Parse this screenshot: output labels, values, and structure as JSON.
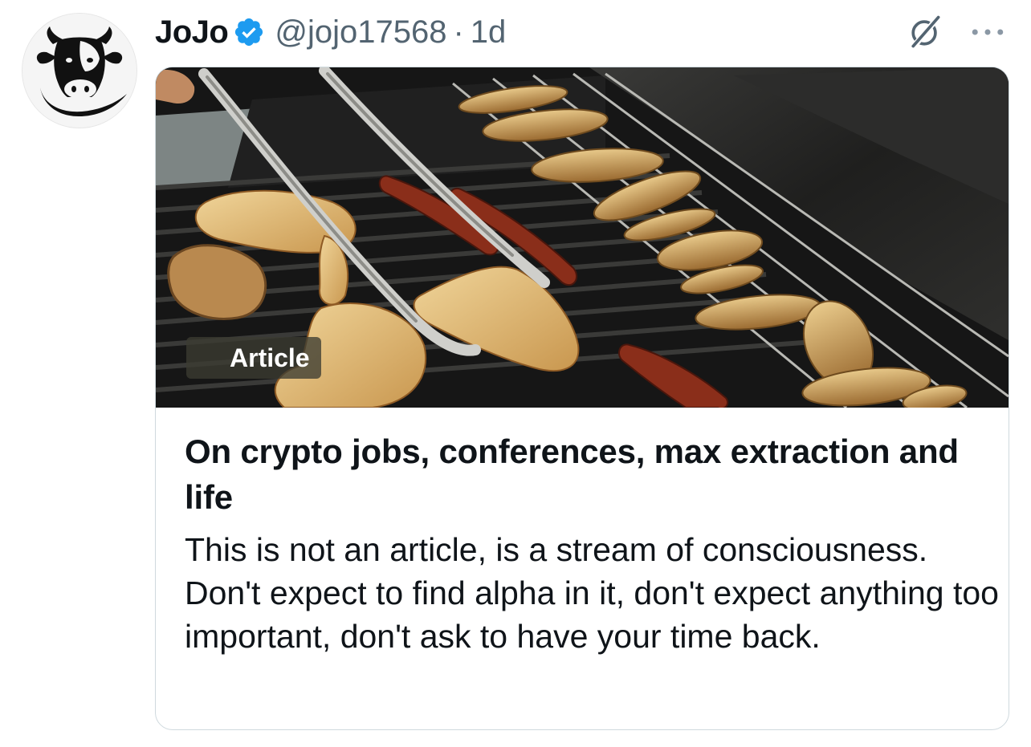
{
  "author": {
    "display_name": "JoJo",
    "handle": "@jojo17568",
    "separator": "·",
    "time": "1d",
    "verified": true,
    "avatar_icon": "cow-head-logo"
  },
  "actions": {
    "grok_icon": "grok-icon",
    "more_icon": "more-dots-icon"
  },
  "article": {
    "badge_label": "Article",
    "badge_icon": "x-logo-icon",
    "title": "On crypto jobs, conferences, max extraction and life",
    "description": "This is not an article, is a stream of consciousness. Don't expect to find alpha in it, don't expect anything too important, don't ask to have your time back."
  },
  "colors": {
    "verified_blue": "#1d9bf0",
    "secondary_text": "#536471",
    "primary_text": "#0f1419",
    "border": "#cfd9de"
  }
}
